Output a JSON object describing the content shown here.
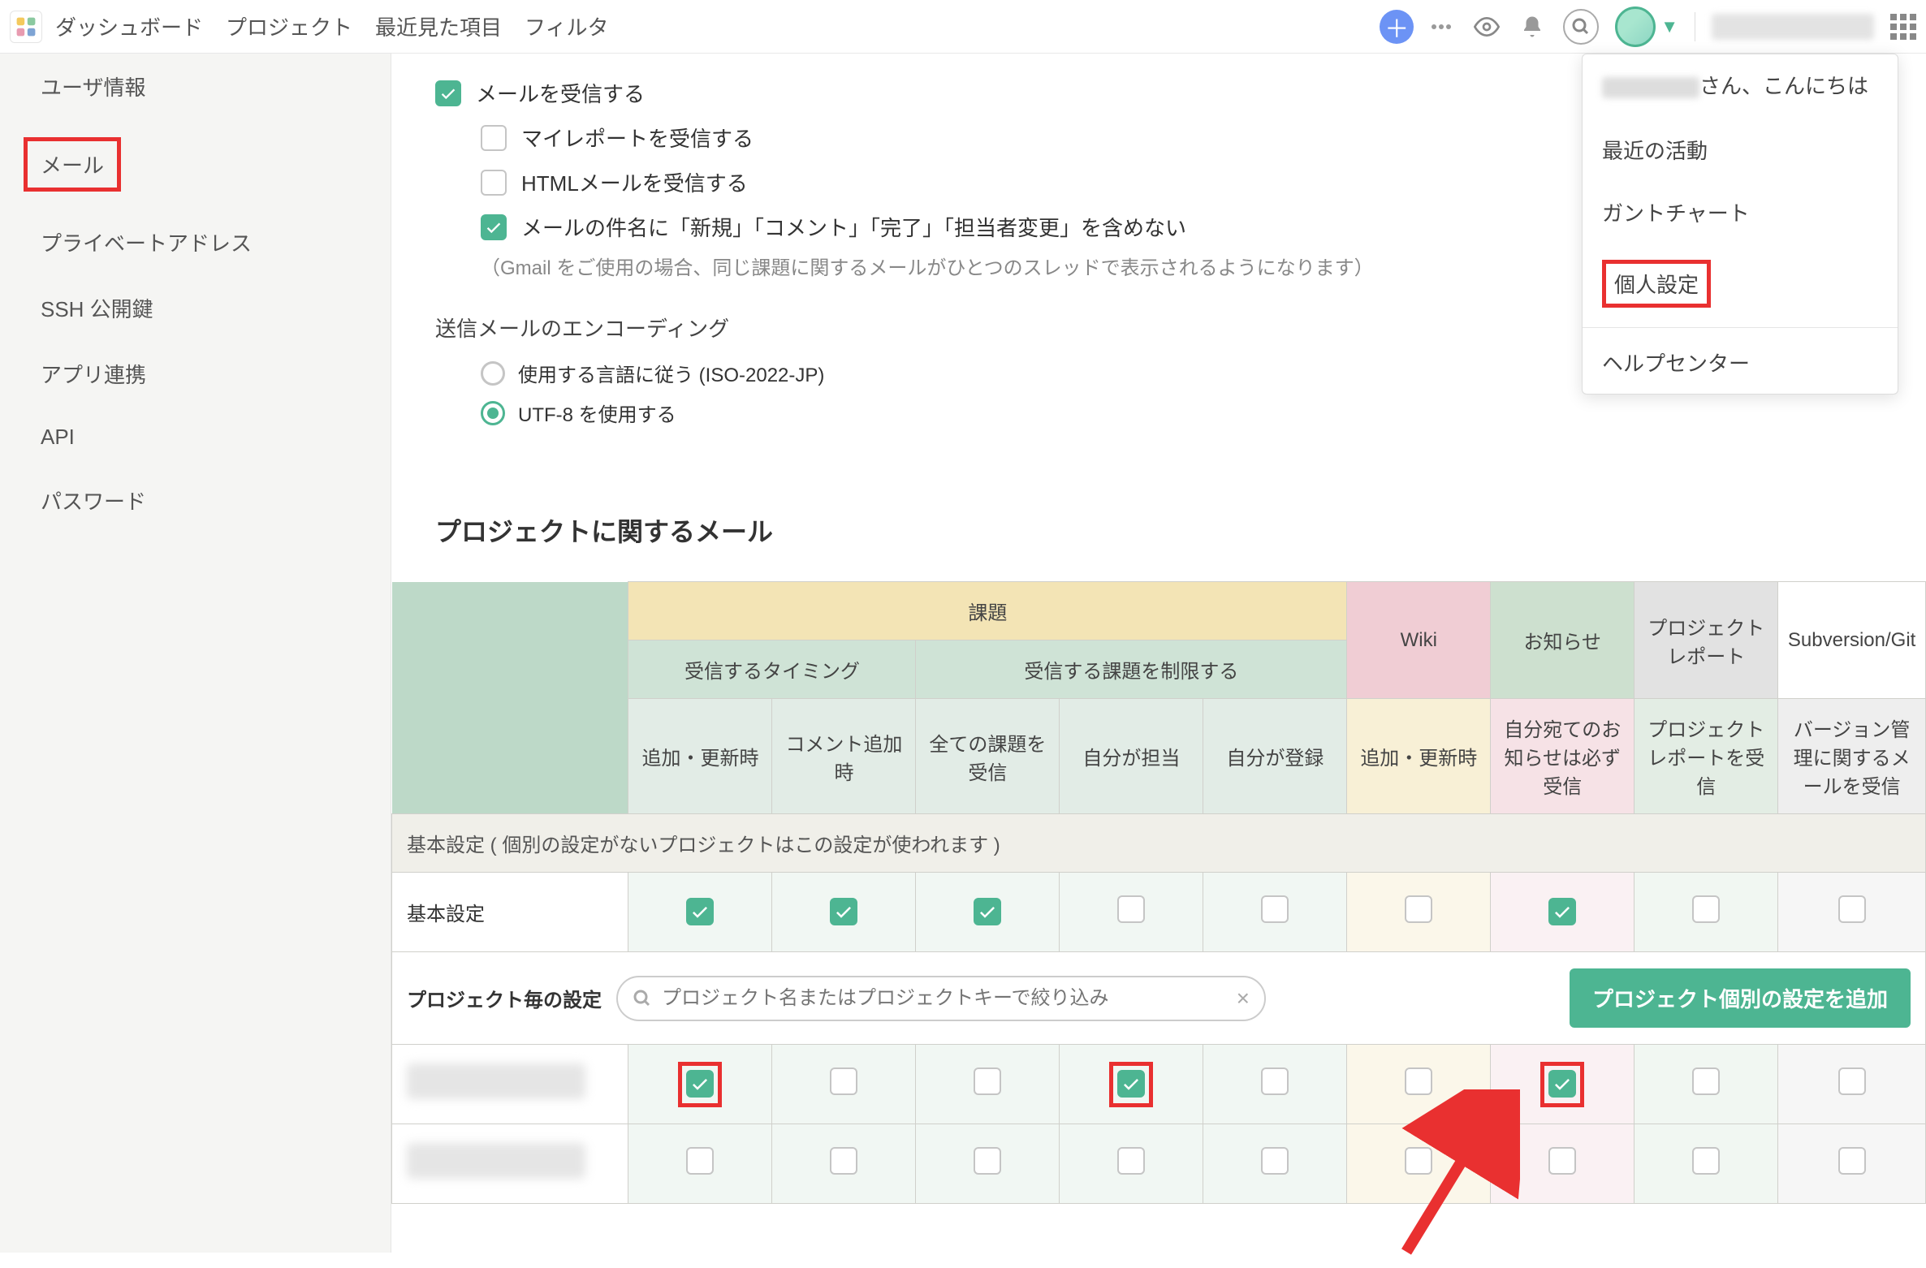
{
  "header": {
    "nav": [
      "ダッシュボード",
      "プロジェクト",
      "最近見た項目",
      "フィルタ"
    ]
  },
  "sidebar": {
    "items": [
      {
        "label": "ユーザ情報"
      },
      {
        "label": "メール"
      },
      {
        "label": "プライベートアドレス"
      },
      {
        "label": "SSH 公開鍵"
      },
      {
        "label": "アプリ連携"
      },
      {
        "label": "API"
      },
      {
        "label": "パスワード"
      }
    ]
  },
  "mailSettings": {
    "receive": "メールを受信する",
    "myreport": "マイレポートを受信する",
    "html": "HTMLメールを受信する",
    "subjectOmit": "メールの件名に「新規」「コメント」「完了」「担当者変更」を含めない",
    "subjectHint": "（Gmail をご使用の場合、同じ課題に関するメールがひとつのスレッドで表示されるようになります）"
  },
  "encoding": {
    "heading": "送信メールのエンコーディング",
    "options": [
      "使用する言語に従う (ISO-2022-JP)",
      "UTF-8 を使用する"
    ]
  },
  "projectMail": {
    "heading": "プロジェクトに関するメール",
    "headers": {
      "issue": "課題",
      "wiki": "Wiki",
      "notice": "お知らせ",
      "report": "プロジェクトレポート",
      "svn": "Subversion/Git",
      "timing": "受信するタイミング",
      "restrict": "受信する課題を制限する",
      "cols": [
        "追加・更新時",
        "コメント追加時",
        "全ての課題を受信",
        "自分が担当",
        "自分が登録",
        "追加・更新時",
        "自分宛てのお知らせは必ず受信",
        "プロジェクトレポートを受信",
        "バージョン管理に関するメールを受信"
      ]
    },
    "baseRowHeader": "基本設定 ( 個別の設定がないプロジェクトはこの設定が使われます )",
    "baseLabel": "基本設定",
    "perProjectLabel": "プロジェクト毎の設定",
    "searchPlaceholder": "プロジェクト名またはプロジェクトキーで絞り込み",
    "addBtn": "プロジェクト個別の設定を追加",
    "baseChecks": [
      true,
      true,
      true,
      false,
      false,
      false,
      true,
      false,
      false
    ],
    "projects": [
      {
        "checks": [
          true,
          false,
          false,
          true,
          false,
          false,
          true,
          false,
          false
        ],
        "hl": [
          true,
          false,
          false,
          true,
          false,
          false,
          true,
          false,
          false
        ]
      },
      {
        "checks": [
          false,
          false,
          false,
          false,
          false,
          false,
          false,
          false,
          false
        ],
        "hl": [
          false,
          false,
          false,
          false,
          false,
          false,
          false,
          false,
          false
        ]
      }
    ]
  },
  "dropdown": {
    "greeting_suffix": "さん、こんにちは",
    "items": [
      "最近の活動",
      "ガントチャート",
      "個人設定",
      "ヘルプセンター"
    ]
  }
}
